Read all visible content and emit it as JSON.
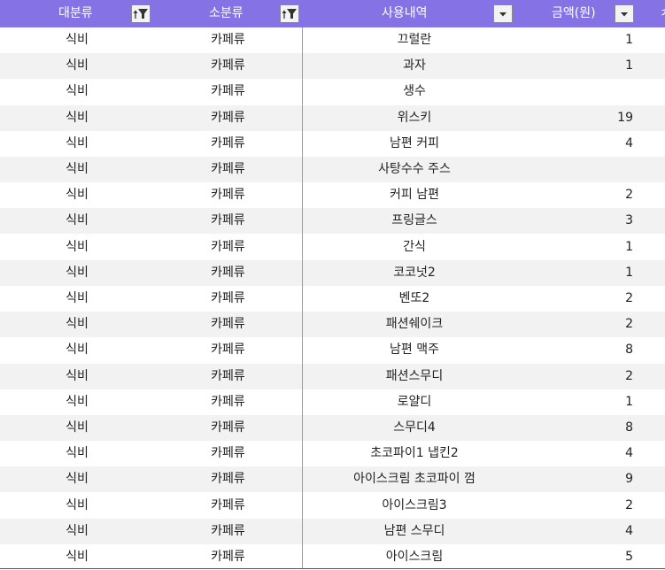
{
  "header": {
    "col1": "대분류",
    "col2": "소분류",
    "col3": "사용내역",
    "col4": "금액(원)",
    "col5_partial": "ㅊ"
  },
  "colors": {
    "header_bg": "#8573e6",
    "header_text": "#ffffff",
    "stripe": "#f2f2f2"
  },
  "rows": [
    {
      "category": "식비",
      "subcategory": "카페류",
      "item": "끄럴란",
      "amount": "1"
    },
    {
      "category": "식비",
      "subcategory": "카페류",
      "item": "과자",
      "amount": "1"
    },
    {
      "category": "식비",
      "subcategory": "카페류",
      "item": "생수",
      "amount": ""
    },
    {
      "category": "식비",
      "subcategory": "카페류",
      "item": "위스키",
      "amount": "19"
    },
    {
      "category": "식비",
      "subcategory": "카페류",
      "item": "남편 커피",
      "amount": "4"
    },
    {
      "category": "식비",
      "subcategory": "카페류",
      "item": "사탕수수 주스",
      "amount": ""
    },
    {
      "category": "식비",
      "subcategory": "카페류",
      "item": "커피 남편",
      "amount": "2"
    },
    {
      "category": "식비",
      "subcategory": "카페류",
      "item": "프링글스",
      "amount": "3"
    },
    {
      "category": "식비",
      "subcategory": "카페류",
      "item": "간식",
      "amount": "1"
    },
    {
      "category": "식비",
      "subcategory": "카페류",
      "item": "코코넛2",
      "amount": "1"
    },
    {
      "category": "식비",
      "subcategory": "카페류",
      "item": "벤또2",
      "amount": "2"
    },
    {
      "category": "식비",
      "subcategory": "카페류",
      "item": "패션쉐이크",
      "amount": "2"
    },
    {
      "category": "식비",
      "subcategory": "카페류",
      "item": "남편 맥주",
      "amount": "8"
    },
    {
      "category": "식비",
      "subcategory": "카페류",
      "item": "패션스무디",
      "amount": "2"
    },
    {
      "category": "식비",
      "subcategory": "카페류",
      "item": "로얄디",
      "amount": "1"
    },
    {
      "category": "식비",
      "subcategory": "카페류",
      "item": "스무디4",
      "amount": "8"
    },
    {
      "category": "식비",
      "subcategory": "카페류",
      "item": "초코파이1 냅킨2",
      "amount": "4"
    },
    {
      "category": "식비",
      "subcategory": "카페류",
      "item": "아이스크림 초코파이 껌",
      "amount": "9"
    },
    {
      "category": "식비",
      "subcategory": "카페류",
      "item": "아이스크림3",
      "amount": "2"
    },
    {
      "category": "식비",
      "subcategory": "카페류",
      "item": "남편 스무디",
      "amount": "4"
    },
    {
      "category": "식비",
      "subcategory": "카페류",
      "item": "아이스크림",
      "amount": "5"
    }
  ]
}
